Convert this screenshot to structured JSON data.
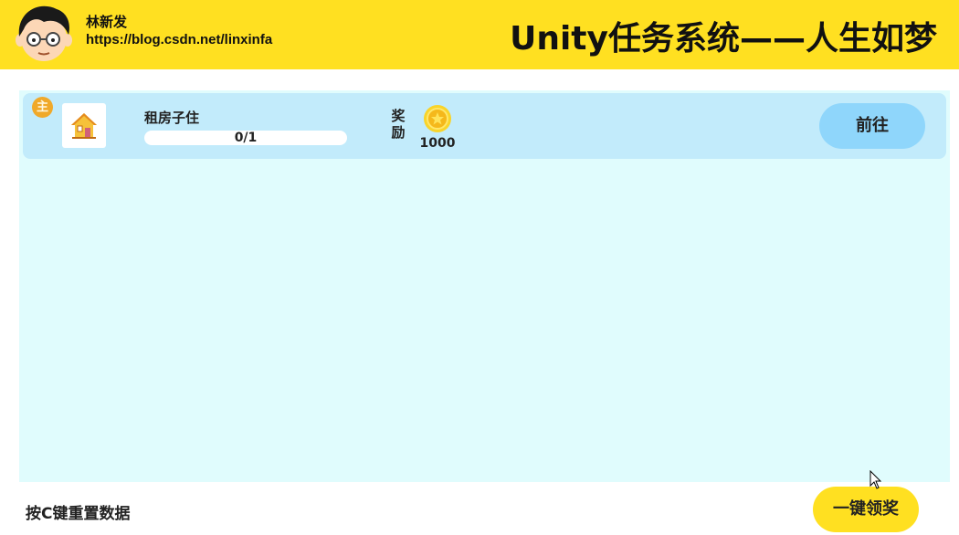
{
  "header": {
    "author_name": "林新发",
    "author_url": "https://blog.csdn.net/linxinfa",
    "title": "Unity任务系统——人生如梦",
    "accent_color": "#ffe021"
  },
  "task_list": {
    "background_color": "#e0fcfd",
    "tasks": [
      {
        "badge": "主",
        "icon": "house-icon",
        "name": "租房子住",
        "progress_text": "0/1",
        "progress": 0,
        "reward_label": "奖励",
        "reward_icon": "gold-coin-icon",
        "reward_amount": "1000",
        "action_label": "前往"
      }
    ]
  },
  "footer": {
    "hint": "按C键重置数据",
    "claim_all_label": "一键领奖"
  }
}
